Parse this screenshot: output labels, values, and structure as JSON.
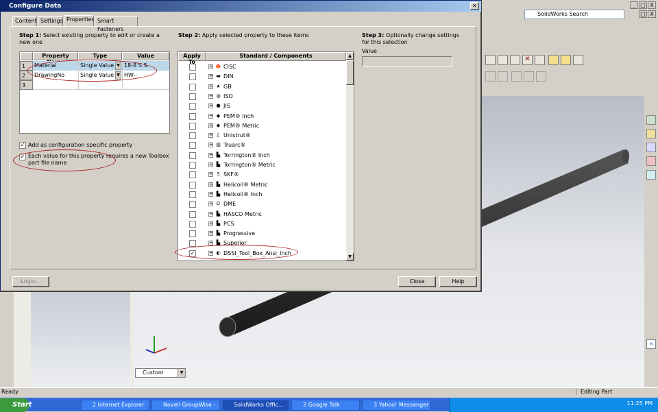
{
  "background": {
    "search_label": "SolidWorks Search",
    "view_dropdown": "Custom",
    "status_left": "Ready",
    "status_right": "Editing Part",
    "window_controls": [
      "_",
      "□",
      "X"
    ]
  },
  "dialog": {
    "title": "Configure Data",
    "tabs": [
      "Content",
      "Settings",
      "Properties",
      "Smart Fasteners"
    ],
    "step1": {
      "heading": "Step 1:",
      "text": "Select existing property to edit or create a new one",
      "columns": [
        "Property Name",
        "Type",
        "Value"
      ],
      "rows": [
        {
          "num": "1",
          "name": "Material",
          "type": "Single Value",
          "value": "18-8 S.S."
        },
        {
          "num": "2",
          "name": "DrawingNo",
          "type": "Single Value",
          "value": "HW-"
        },
        {
          "num": "3",
          "name": "",
          "type": "",
          "value": ""
        }
      ],
      "config_specific_label": "Add as configuration specific property",
      "new_file_label": "Each value for this property requires a new Toolbox part file name"
    },
    "step2": {
      "heading": "Step 2:",
      "text": "Apply selected property to these items",
      "columns": [
        "Apply To",
        "Standard / Components"
      ],
      "items": [
        {
          "label": "CISC",
          "icon": "canada-flag-icon",
          "checked": false
        },
        {
          "label": "DIN",
          "icon": "germany-flag-icon",
          "checked": false
        },
        {
          "label": "GB",
          "icon": "china-flag-icon",
          "checked": false
        },
        {
          "label": "ISO",
          "icon": "iso-logo-icon",
          "checked": false
        },
        {
          "label": "JIS",
          "icon": "japan-flag-icon",
          "checked": false
        },
        {
          "label": "PEM® Inch",
          "icon": "pem-logo-icon",
          "checked": false
        },
        {
          "label": "PEM® Metric",
          "icon": "pem-logo-icon",
          "checked": false
        },
        {
          "label": "Unistrut®",
          "icon": "unistrut-logo-icon",
          "checked": false
        },
        {
          "label": "Truarc®",
          "icon": "truarc-logo-icon",
          "checked": false
        },
        {
          "label": "Torrington® Inch",
          "icon": "factory-icon",
          "checked": false
        },
        {
          "label": "Torrington® Metric",
          "icon": "factory-icon",
          "checked": false
        },
        {
          "label": "SKF®",
          "icon": "skf-logo-icon",
          "checked": false
        },
        {
          "label": "Helicoil® Metric",
          "icon": "factory-icon",
          "checked": false
        },
        {
          "label": "Helicoil® Inch",
          "icon": "factory-icon",
          "checked": false
        },
        {
          "label": "DME",
          "icon": "dme-logo-icon",
          "checked": false
        },
        {
          "label": "HASCO Metric",
          "icon": "factory-icon",
          "checked": false
        },
        {
          "label": "PCS",
          "icon": "factory-icon",
          "checked": false
        },
        {
          "label": "Progressive",
          "icon": "factory-icon",
          "checked": false
        },
        {
          "label": "Superior",
          "icon": "factory-icon",
          "checked": false
        },
        {
          "label": "DSSI_Tool_Box_Ansi_Inch",
          "icon": "toolbox-icon",
          "checked": true
        }
      ]
    },
    "step3": {
      "heading": "Step 3:",
      "text": "Optionally change settings for this selection",
      "value_label": "Value"
    },
    "buttons": {
      "login": "Login...",
      "close": "Close",
      "help": "Help"
    }
  },
  "taskbar": {
    "start": "Start",
    "items": [
      "2 Internet Explorer",
      "Novell GroupWise - ...",
      "SolidWorks Offic...",
      "2 Google Talk",
      "3 Yahoo! Messenger"
    ],
    "clock": "11:25 PM"
  },
  "colors": {
    "title_start": "#0a246a",
    "title_end": "#a6caf0",
    "taskbar": "#3168d5",
    "annotation": "#b02020"
  }
}
